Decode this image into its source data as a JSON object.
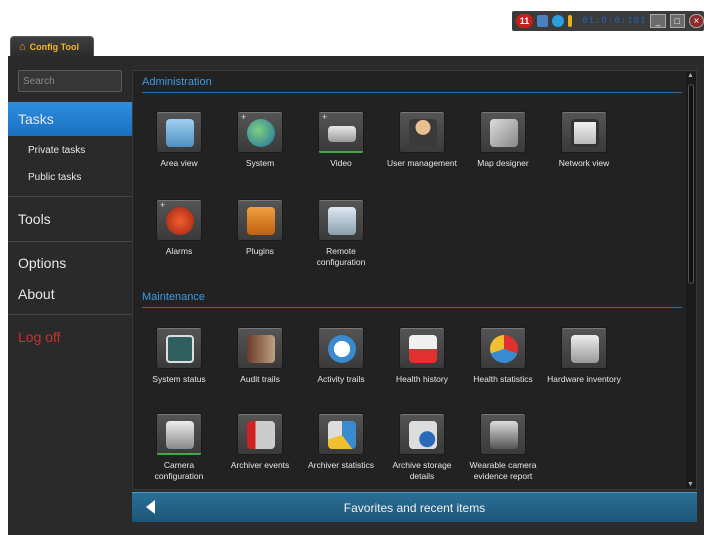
{
  "tray": {
    "notification_count": "11",
    "clock": "01:0:0:101",
    "min_label": "_",
    "max_label": "□",
    "close_label": "×"
  },
  "tab": {
    "label": "Config Tool"
  },
  "sidebar": {
    "search_placeholder": "Search",
    "tasks": "Tasks",
    "private_tasks": "Private tasks",
    "public_tasks": "Public tasks",
    "tools": "Tools",
    "options": "Options",
    "about": "About",
    "logoff": "Log off"
  },
  "administration": {
    "title": "Administration",
    "items": [
      {
        "label": "Area view",
        "icon": "building-icon"
      },
      {
        "label": "System",
        "icon": "globe-icon"
      },
      {
        "label": "Video",
        "icon": "camera-icon"
      },
      {
        "label": "User management",
        "icon": "user-icon"
      },
      {
        "label": "Map designer",
        "icon": "map-icon"
      },
      {
        "label": "Network view",
        "icon": "network-icon"
      },
      {
        "label": "Alarms",
        "icon": "alarm-icon"
      },
      {
        "label": "Plugins",
        "icon": "puzzle-icon"
      },
      {
        "label": "Remote configuration",
        "icon": "remote-config-icon"
      }
    ]
  },
  "maintenance": {
    "title": "Maintenance",
    "items": [
      {
        "label": "System status",
        "icon": "monitor-icon"
      },
      {
        "label": "Audit trails",
        "icon": "audit-icon"
      },
      {
        "label": "Activity trails",
        "icon": "clock-icon"
      },
      {
        "label": "Health history",
        "icon": "calendar-icon"
      },
      {
        "label": "Health statistics",
        "icon": "pie-chart-icon"
      },
      {
        "label": "Hardware inventory",
        "icon": "hardware-icon"
      },
      {
        "label": "Camera configuration",
        "icon": "camera-config-icon"
      },
      {
        "label": "Archiver events",
        "icon": "database-flag-icon"
      },
      {
        "label": "Archiver statistics",
        "icon": "database-chart-icon"
      },
      {
        "label": "Archive storage details",
        "icon": "storage-info-icon"
      },
      {
        "label": "Wearable camera evidence report",
        "icon": "wearable-camera-icon"
      }
    ]
  },
  "favorites": {
    "label": "Favorites and recent items"
  },
  "colors": {
    "accent": "#3b9be8",
    "selected": "#1f79cc",
    "logoff": "#c83232",
    "favbar": "#1d5678"
  }
}
